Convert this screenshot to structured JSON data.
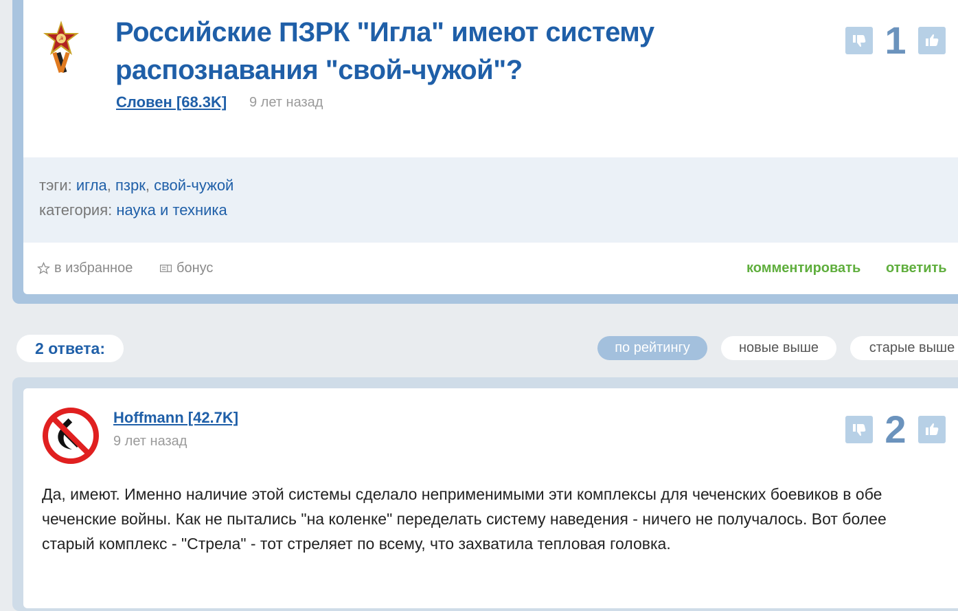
{
  "question": {
    "title": "Российские ПЗРК \"Игла\" имеют систему распознавания \"свой-чужой\"?",
    "author": "Словен [68.3K]",
    "time": "9 лет назад",
    "vote_count": "1",
    "tags_label": "тэги:",
    "tags": [
      "игла",
      "пзрк",
      "свой-чужой"
    ],
    "category_label": "категория:",
    "category": "наука и техника",
    "favorite_label": "в избранное",
    "bonus_label": "бонус",
    "comment_label": "комментировать",
    "answer_label": "ответить"
  },
  "answers_header": {
    "count_label": "2 ответа:",
    "sort_options": [
      "по рейтингу",
      "новые выше",
      "старые выше"
    ],
    "active_sort": "по рейтингу"
  },
  "answer": {
    "author": "Hoffmann [42.7K]",
    "time": "9 лет назад",
    "vote_count": "2",
    "text": "Да, имеют. Именно наличие этой системы сделало неприменимыми эти комплексы для чеченских боевиков в обе чеченские войны. Как не пытались \"на коленке\" переделать систему наведения - ничего не получалось. Вот более старый комплекс - \"Стрела\" - тот стреляет по всему, что захватила тепловая головка."
  },
  "colors": {
    "link": "#1f5fa8",
    "vote_button": "#b7d0e6",
    "vote_count": "#6b93bd",
    "action_green": "#5fae3d",
    "active_sort": "#a3c0dd"
  }
}
